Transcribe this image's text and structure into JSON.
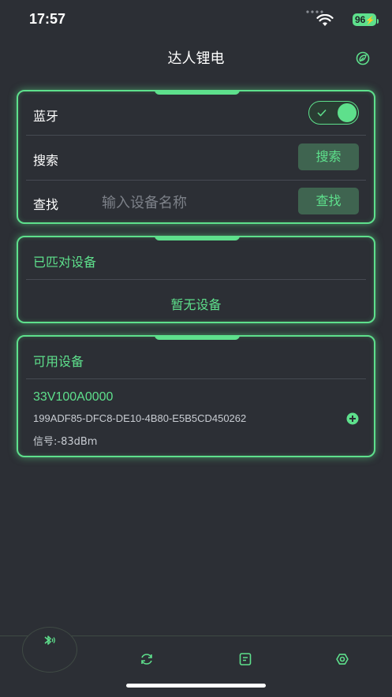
{
  "status_bar": {
    "time": "17:57",
    "battery": "96"
  },
  "nav": {
    "title": "达人锂电",
    "settings_icon": "leaf-settings-icon"
  },
  "bluetooth_card": {
    "bluetooth_label": "蓝牙",
    "bluetooth_on": true,
    "search_label": "搜索",
    "search_button": "搜索",
    "find_label": "查找",
    "find_placeholder": "输入设备名称",
    "find_button": "查找"
  },
  "paired_card": {
    "title": "已匹对设备",
    "empty_text": "暂无设备"
  },
  "available_card": {
    "title": "可用设备",
    "devices": [
      {
        "name": "33V100A0000",
        "uuid": "199ADF85-DFC8-DE10-4B80-E5B5CD450262",
        "signal": "信号:-83dBm"
      }
    ]
  },
  "tabbar": {
    "tabs": [
      "bluetooth-icon",
      "refresh-icon",
      "document-icon",
      "settings-icon"
    ]
  },
  "colors": {
    "accent": "#5ee08c",
    "background": "#2c2f35",
    "button_bg": "#3f6450"
  }
}
